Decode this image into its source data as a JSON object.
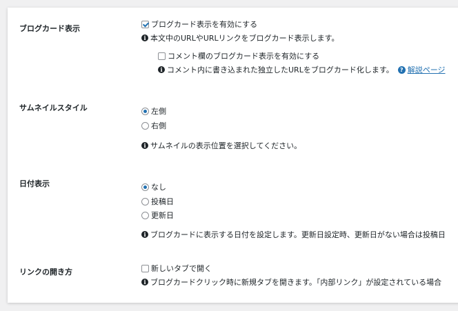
{
  "blogcard": {
    "label": "ブログカード表示",
    "enable_label": "ブログカード表示を有効にする",
    "enable_checked": true,
    "enable_help": "本文中のURLやURLリンクをブログカード表示します。",
    "comment_label": "コメント欄のブログカード表示を有効にする",
    "comment_checked": false,
    "comment_help": "コメント内に書き込まれた独立したURLをブログカード化します。",
    "comment_link": "解説ページ"
  },
  "thumbnail": {
    "label": "サムネイルスタイル",
    "options": [
      {
        "label": "左側",
        "checked": true
      },
      {
        "label": "右側",
        "checked": false
      }
    ],
    "help": "サムネイルの表示位置を選択してください。"
  },
  "date": {
    "label": "日付表示",
    "options": [
      {
        "label": "なし",
        "checked": true
      },
      {
        "label": "投稿日",
        "checked": false
      },
      {
        "label": "更新日",
        "checked": false
      }
    ],
    "help": "ブログカードに表示する日付を設定します。更新日設定時、更新日がない場合は投稿日"
  },
  "link_open": {
    "label": "リンクの開き方",
    "new_tab_label": "新しいタブで開く",
    "new_tab_checked": false,
    "help": "ブログカードクリック時に新規タブを開きます。「内部リンク」が設定されている場合"
  },
  "colors": {
    "accent": "#2271b1",
    "text": "#1d2327",
    "border": "#8c8f94"
  },
  "icons": {
    "info": "info-icon",
    "help": "help-icon"
  }
}
